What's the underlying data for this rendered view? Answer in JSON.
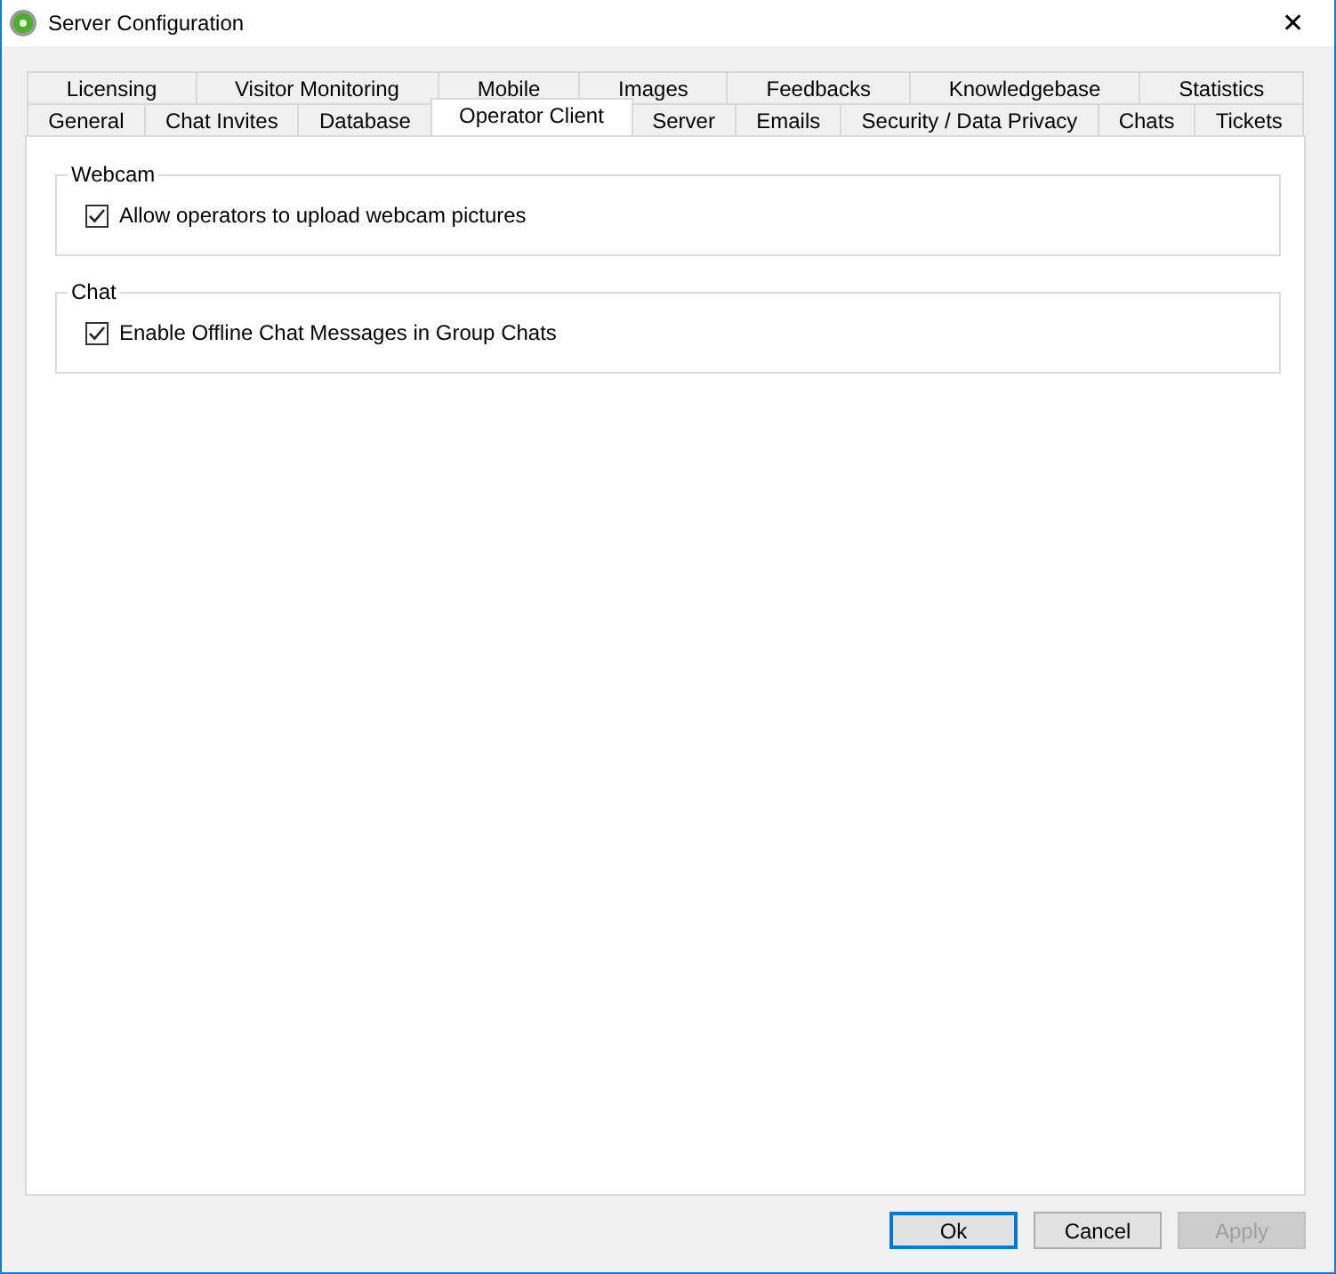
{
  "window": {
    "title": "Server Configuration",
    "close": "✕"
  },
  "tab_rows": [
    [
      {
        "label": "Licensing",
        "selected": false
      },
      {
        "label": "Visitor Monitoring",
        "selected": false
      },
      {
        "label": "Mobile",
        "selected": false
      },
      {
        "label": "Images",
        "selected": false
      },
      {
        "label": "Feedbacks",
        "selected": false
      },
      {
        "label": "Knowledgebase",
        "selected": false
      },
      {
        "label": "Statistics",
        "selected": false
      }
    ],
    [
      {
        "label": "General",
        "selected": false
      },
      {
        "label": "Chat Invites",
        "selected": false
      },
      {
        "label": "Database",
        "selected": false
      },
      {
        "label": "Operator Client",
        "selected": true
      },
      {
        "label": "Server",
        "selected": false
      },
      {
        "label": "Emails",
        "selected": false
      },
      {
        "label": "Security / Data Privacy",
        "selected": false
      },
      {
        "label": "Chats",
        "selected": false
      },
      {
        "label": "Tickets",
        "selected": false
      }
    ]
  ],
  "groups": [
    {
      "title": "Webcam",
      "options": [
        {
          "label": "Allow operators to upload webcam pictures",
          "checked": true
        }
      ]
    },
    {
      "title": "Chat",
      "options": [
        {
          "label": "Enable Offline Chat Messages in Group Chats",
          "checked": true
        }
      ]
    }
  ],
  "buttons": [
    {
      "label": "Ok",
      "default": true,
      "disabled": false
    },
    {
      "label": "Cancel",
      "default": false,
      "disabled": false
    },
    {
      "label": "Apply",
      "default": false,
      "disabled": true
    }
  ]
}
